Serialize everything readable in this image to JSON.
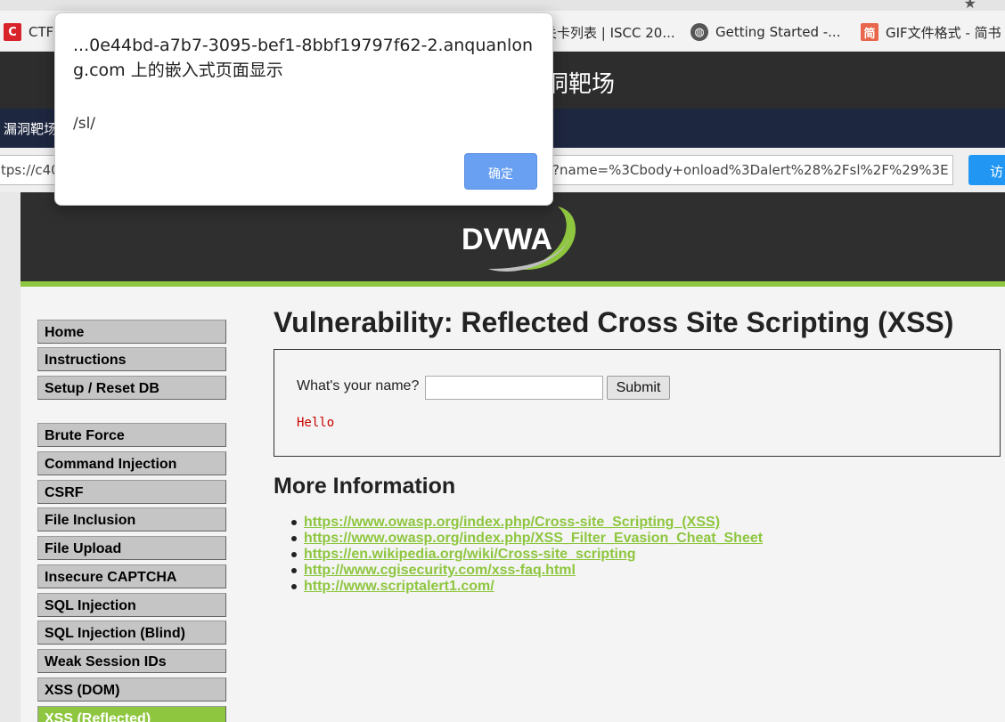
{
  "bookmarks": [
    {
      "label": "CTF",
      "icon": "ctf-c-icon"
    },
    {
      "label": "关卡列表 | ISCC 20...",
      "icon": ""
    },
    {
      "label": "Getting Started -...",
      "icon": "globe-icon"
    },
    {
      "label": "GIF文件格式 - 简书",
      "icon": "jianshu-icon"
    }
  ],
  "site": {
    "title": "洞靶场",
    "nav_item": "漏洞靶场"
  },
  "url_bar": {
    "value_start": "tps://c40",
    "value_end": "/?name=%3Cbody+onload%3Dalert%28%2Fsl%2F%29%3E",
    "visit_label": "访"
  },
  "dvwa": {
    "logo_text": "DVWA",
    "menu": [
      {
        "label": "Home"
      },
      {
        "label": "Instructions"
      },
      {
        "label": "Setup / Reset DB"
      },
      {
        "label": "Brute Force"
      },
      {
        "label": "Command Injection"
      },
      {
        "label": "CSRF"
      },
      {
        "label": "File Inclusion"
      },
      {
        "label": "File Upload"
      },
      {
        "label": "Insecure CAPTCHA"
      },
      {
        "label": "SQL Injection"
      },
      {
        "label": "SQL Injection (Blind)"
      },
      {
        "label": "Weak Session IDs"
      },
      {
        "label": "XSS (DOM)"
      },
      {
        "label": "XSS (Reflected)",
        "active": true
      }
    ],
    "page_title": "Vulnerability: Reflected Cross Site Scripting (XSS)",
    "form": {
      "question": "What's your name?",
      "input_value": "",
      "submit_label": "Submit",
      "output": "Hello"
    },
    "more_info_title": "More Information",
    "links": [
      "https://www.owasp.org/index.php/Cross-site_Scripting_(XSS)",
      "https://www.owasp.org/index.php/XSS_Filter_Evasion_Cheat_Sheet",
      "https://en.wikipedia.org/wiki/Cross-site_scripting",
      "http://www.cgisecurity.com/xss-faq.html",
      "http://www.scriptalert1.com/"
    ],
    "accent_color": "#8ec63f"
  },
  "alert": {
    "title": "...0e44bd-a7b7-3095-bef1-8bbf19797f62-2.anquanlong.com 上的嵌入式页面显示",
    "message": "/sl/",
    "ok_label": "确定"
  }
}
